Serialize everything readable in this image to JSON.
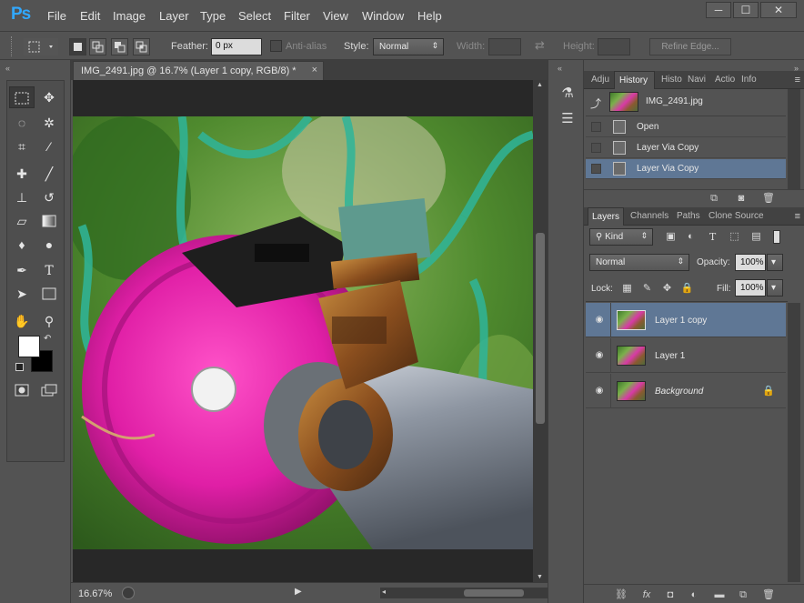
{
  "app": {
    "logo": "Ps"
  },
  "menu": [
    "File",
    "Edit",
    "Image",
    "Layer",
    "Type",
    "Select",
    "Filter",
    "View",
    "Window",
    "Help"
  ],
  "window_controls": {
    "minimize": "─",
    "maximize": "☐",
    "close": "✕"
  },
  "options_bar": {
    "feather_label": "Feather:",
    "feather_value": "0 px",
    "antialias_label": "Anti-alias",
    "style_label": "Style:",
    "style_value": "Normal",
    "width_label": "Width:",
    "height_label": "Height:",
    "refine_edge": "Refine Edge..."
  },
  "document": {
    "tab_title": "IMG_2491.jpg @ 16.7% (Layer 1 copy, RGB/8) *",
    "tab_close": "×",
    "zoom": "16.67%"
  },
  "history_panel": {
    "tabs": [
      "Adju",
      "History",
      "Histo",
      "Navi",
      "Actio",
      "Info"
    ],
    "active_tab": "History",
    "snapshot_name": "IMG_2491.jpg",
    "states": [
      {
        "label": "Open",
        "active": false
      },
      {
        "label": "Layer Via Copy",
        "active": false
      },
      {
        "label": "Layer Via Copy",
        "active": true
      }
    ]
  },
  "layers_panel": {
    "tabs": [
      "Layers",
      "Channels",
      "Paths",
      "Clone Source"
    ],
    "active_tab": "Layers",
    "filter_kind": "Kind",
    "blend_mode": "Normal",
    "opacity_label": "Opacity:",
    "opacity_value": "100%",
    "lock_label": "Lock:",
    "fill_label": "Fill:",
    "fill_value": "100%",
    "layers": [
      {
        "name": "Layer 1 copy",
        "active": true,
        "italic": false,
        "locked": false
      },
      {
        "name": "Layer 1",
        "active": false,
        "italic": false,
        "locked": false
      },
      {
        "name": "Background",
        "active": false,
        "italic": true,
        "locked": true
      }
    ]
  },
  "colors": {
    "foreground": "#ffffff",
    "background": "#000000",
    "selection": "#5f7795",
    "accent": "#31a8ff"
  }
}
